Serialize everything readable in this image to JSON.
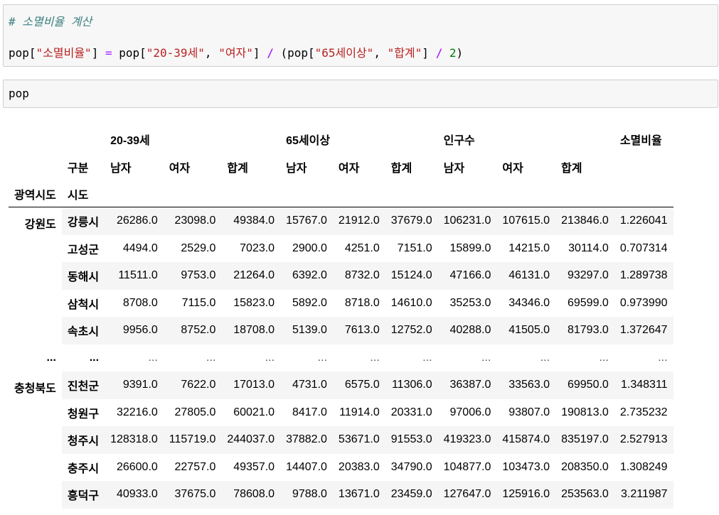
{
  "cell1": {
    "comment": "# 소멸비율 계산",
    "code": {
      "var": "pop[",
      "key": "\"소멸비율\"",
      "close1": "] ",
      "eq": "=",
      "p1": " pop[",
      "k1": "\"20-39세\"",
      "comma1": ", ",
      "k2": "\"여자\"",
      "close2": "] ",
      "div1": "/",
      "p2": " (pop[",
      "k3": "\"65세이상\"",
      "comma2": ", ",
      "k4": "\"합계\"",
      "close3": "] ",
      "div2": "/",
      "space": " ",
      "num": "2",
      "paren": ")"
    }
  },
  "cell2": {
    "code": "pop"
  },
  "table": {
    "group_headers": [
      "20-39세",
      "65세이상",
      "인구수",
      "소멸비율"
    ],
    "col_index_name": "구분",
    "sub_headers": [
      "남자",
      "여자",
      "합계",
      "남자",
      "여자",
      "합계",
      "남자",
      "여자",
      "합계"
    ],
    "row_index_names": [
      "광역시도",
      "시도"
    ],
    "group1": {
      "region": "강원도",
      "rows": [
        {
          "city": "강릉시",
          "v": [
            "26286.0",
            "23098.0",
            "49384.0",
            "15767.0",
            "21912.0",
            "37679.0",
            "106231.0",
            "107615.0",
            "213846.0",
            "1.226041"
          ]
        },
        {
          "city": "고성군",
          "v": [
            "4494.0",
            "2529.0",
            "7023.0",
            "2900.0",
            "4251.0",
            "7151.0",
            "15899.0",
            "14215.0",
            "30114.0",
            "0.707314"
          ]
        },
        {
          "city": "동해시",
          "v": [
            "11511.0",
            "9753.0",
            "21264.0",
            "6392.0",
            "8732.0",
            "15124.0",
            "47166.0",
            "46131.0",
            "93297.0",
            "1.289738"
          ]
        },
        {
          "city": "삼척시",
          "v": [
            "8708.0",
            "7115.0",
            "15823.0",
            "5892.0",
            "8718.0",
            "14610.0",
            "35253.0",
            "34346.0",
            "69599.0",
            "0.973990"
          ]
        },
        {
          "city": "속초시",
          "v": [
            "9956.0",
            "8752.0",
            "18708.0",
            "5139.0",
            "7613.0",
            "12752.0",
            "40288.0",
            "41505.0",
            "81793.0",
            "1.372647"
          ]
        }
      ]
    },
    "ellipsis": {
      "idx1": "...",
      "idx2": "...",
      "v": [
        "...",
        "...",
        "...",
        "...",
        "...",
        "...",
        "...",
        "...",
        "...",
        "..."
      ]
    },
    "group2": {
      "region": "충청북도",
      "rows": [
        {
          "city": "진천군",
          "v": [
            "9391.0",
            "7622.0",
            "17013.0",
            "4731.0",
            "6575.0",
            "11306.0",
            "36387.0",
            "33563.0",
            "69950.0",
            "1.348311"
          ]
        },
        {
          "city": "청원구",
          "v": [
            "32216.0",
            "27805.0",
            "60021.0",
            "8417.0",
            "11914.0",
            "20331.0",
            "97006.0",
            "93807.0",
            "190813.0",
            "2.735232"
          ]
        },
        {
          "city": "청주시",
          "v": [
            "128318.0",
            "115719.0",
            "244037.0",
            "37882.0",
            "53671.0",
            "91553.0",
            "419323.0",
            "415874.0",
            "835197.0",
            "2.527913"
          ]
        },
        {
          "city": "충주시",
          "v": [
            "26600.0",
            "22757.0",
            "49357.0",
            "14407.0",
            "20383.0",
            "34790.0",
            "104877.0",
            "103473.0",
            "208350.0",
            "1.308249"
          ]
        },
        {
          "city": "흥덕구",
          "v": [
            "40933.0",
            "37675.0",
            "78608.0",
            "9788.0",
            "13671.0",
            "23459.0",
            "127647.0",
            "125916.0",
            "253563.0",
            "3.211987"
          ]
        }
      ]
    }
  }
}
